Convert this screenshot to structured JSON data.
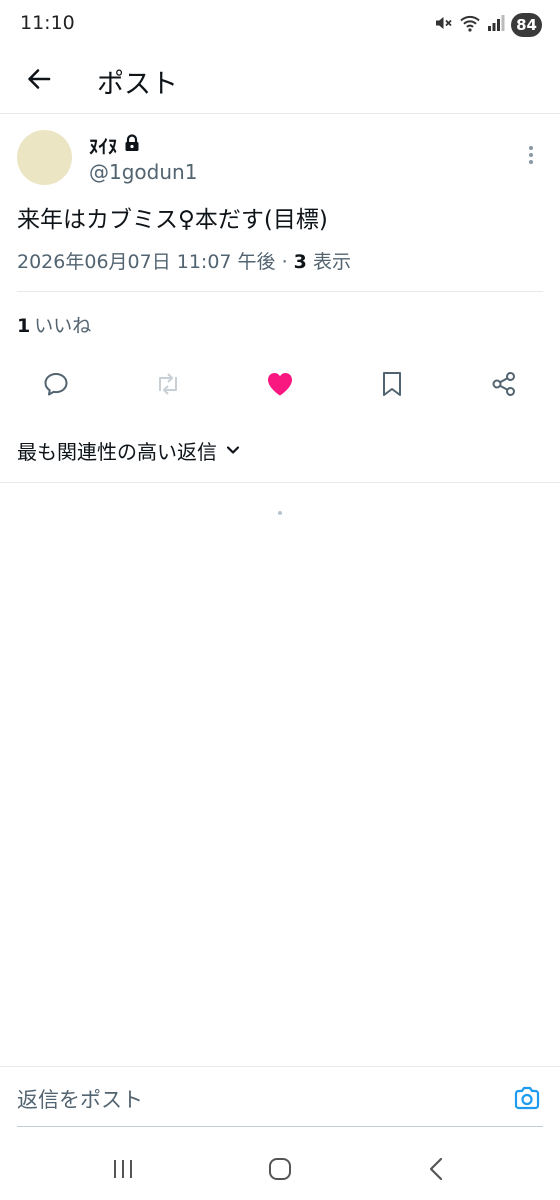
{
  "status_bar": {
    "time": "11:10",
    "battery": "84",
    "icons": [
      "mute-icon",
      "wifi-icon",
      "signal-icon"
    ]
  },
  "header": {
    "title": "ポスト",
    "back_icon": "arrow-left-icon"
  },
  "post": {
    "author": {
      "display_name": "ﾇｲﾇ",
      "handle": "@1godun1",
      "protected_icon": "lock-icon",
      "avatar_color": "#ece5c4"
    },
    "text": "来年はカブミス♀本だす(目標)",
    "timestamp": "2026年06月07日 11:07 午後 · ",
    "views_count": "3",
    "views_label": " 表示",
    "likes_count": "1",
    "likes_label": "いいね"
  },
  "actions": [
    {
      "name": "reply",
      "icon": "reply-icon"
    },
    {
      "name": "repost",
      "icon": "repost-icon"
    },
    {
      "name": "like",
      "icon": "heart-icon",
      "active": true,
      "color": "#f91880"
    },
    {
      "name": "bookmark",
      "icon": "bookmark-icon"
    },
    {
      "name": "share",
      "icon": "share-icon"
    }
  ],
  "replies": {
    "sort_label": "最も関連性の高い返信"
  },
  "reply_bar": {
    "placeholder": "返信をポスト",
    "camera_color": "#1d9bf0"
  },
  "nav": [
    "recents-icon",
    "home-icon",
    "back-icon"
  ]
}
